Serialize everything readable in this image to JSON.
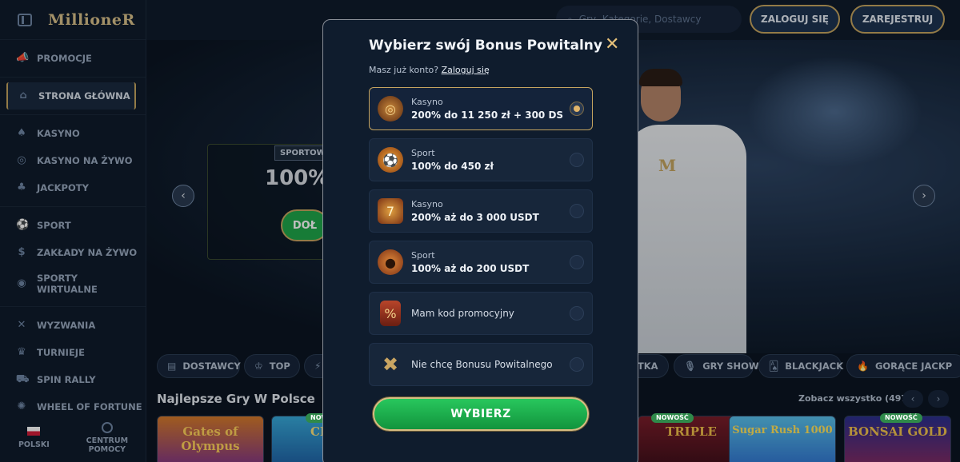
{
  "app": {
    "logo": "MillioneR"
  },
  "topbar": {
    "search_placeholder": "Gry, Kategorie, Dostawcy",
    "login_label": "ZALOGUJ SIĘ",
    "register_label": "ZAREJESTRUJ"
  },
  "sidebar": {
    "groups": [
      [
        {
          "label": "PROMOCJE",
          "icon": "megaphone-icon"
        }
      ],
      [
        {
          "label": "STRONA GŁÓWNA",
          "icon": "home-icon",
          "active": true
        }
      ],
      [
        {
          "label": "KASYNO",
          "icon": "spade-icon"
        },
        {
          "label": "KASYNO NA ŻYWO",
          "icon": "chip-icon"
        },
        {
          "label": "JACKPOTY",
          "icon": "clover-icon"
        }
      ],
      [
        {
          "label": "SPORT",
          "icon": "ball-icon"
        },
        {
          "label": "ZAKŁADY NA ŻYWO",
          "icon": "live-bet-icon"
        },
        {
          "label": "SPORTY WIRTUALNE",
          "icon": "virtual-sport-icon"
        }
      ],
      [
        {
          "label": "WYZWANIA",
          "icon": "swords-icon"
        },
        {
          "label": "TURNIEJE",
          "icon": "trophy-icon"
        },
        {
          "label": "SPIN RALLY",
          "icon": "car-icon"
        },
        {
          "label": "WHEEL OF FORTUNE",
          "icon": "wheel-icon"
        }
      ]
    ],
    "footer": {
      "language": "POLSKI",
      "help_line1": "CENTRUM",
      "help_line2": "POMOCY"
    }
  },
  "hero": {
    "tag": "SPORTOW",
    "headline": "100%",
    "button": "DOŁ"
  },
  "chips": [
    {
      "label": "DOSTAWCY",
      "icon": "book-icon"
    },
    {
      "label": "TOP",
      "icon": "crown-icon"
    },
    {
      "label": "",
      "icon": "bolt-icon"
    },
    {
      "label": "ETKA",
      "icon": ""
    },
    {
      "label": "GRY SHOW",
      "icon": "mic-icon"
    },
    {
      "label": "BLACKJACK",
      "icon": "cards-icon"
    },
    {
      "label": "GORĄCE JACKP",
      "icon": "flame-icon"
    }
  ],
  "games_section": {
    "title": "Najlepsze Gry W Polsce",
    "see_all": "Zobacz wszystko (497)",
    "prev": "‹",
    "next": "›",
    "tiles": [
      {
        "name": "Gates of Olympus",
        "new": false
      },
      {
        "name": "CRA",
        "new": true
      },
      {
        "name": "",
        "new": false
      },
      {
        "name": "TRIPLE",
        "new": true
      },
      {
        "name": "Sugar Rush 1000",
        "new": false
      },
      {
        "name": "BONSAI GOLD",
        "new": true
      }
    ],
    "new_badge": "NOWOŚĆ"
  },
  "modal": {
    "title": "Wybierz swój Bonus Powitalny",
    "have_account": "Masz już konto?",
    "login_link": "Zaloguj się",
    "close": "✕",
    "options": [
      {
        "category": "Kasyno",
        "value": "200% do 11 250 zł + 300 DS",
        "icon": "roulette-icon",
        "selected": true
      },
      {
        "category": "Sport",
        "value": "100% do 450 zł",
        "icon": "football-icon",
        "selected": false
      },
      {
        "category": "Kasyno",
        "value": "200% aż do 3 000 USDT",
        "icon": "slot-machine-icon",
        "selected": false
      },
      {
        "category": "Sport",
        "value": "100% aż do 200 USDT",
        "icon": "basketball-icon",
        "selected": false
      },
      {
        "category": "",
        "value": "Mam kod promocyjny",
        "icon": "promo-ticket-icon",
        "selected": false
      },
      {
        "category": "",
        "value": "Nie chcę Bonusu Powitalnego",
        "icon": "cross-icon",
        "selected": false
      }
    ],
    "submit": "WYBIERZ"
  }
}
